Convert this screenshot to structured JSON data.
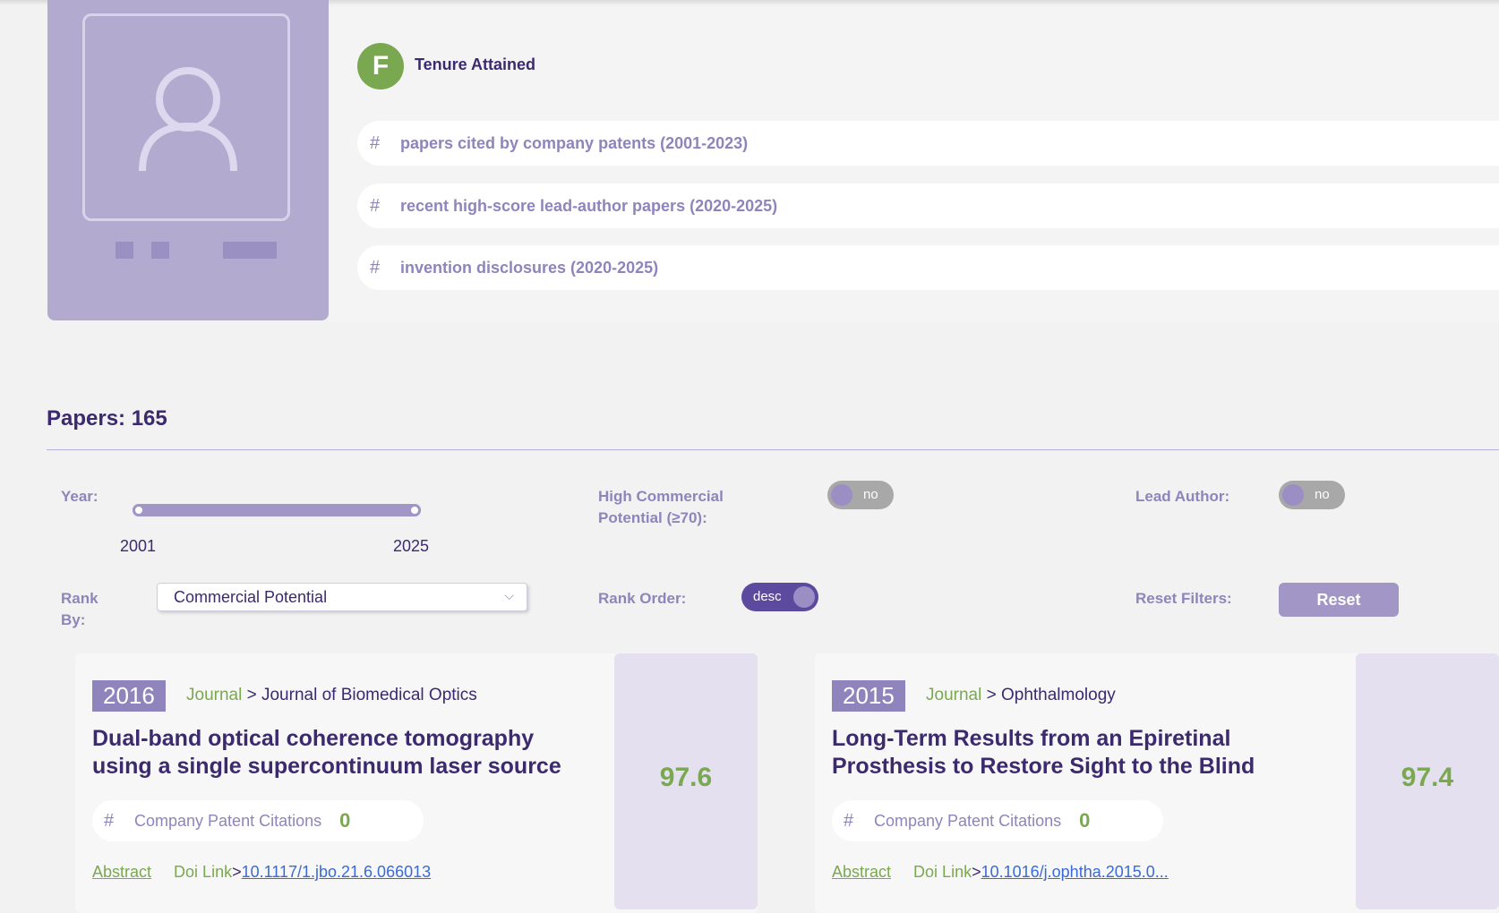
{
  "profile": {
    "tenure_initial": "F",
    "tenure_label": "Tenure Attained",
    "metrics": [
      {
        "label": "papers cited by company patents (2001-2023)"
      },
      {
        "label": "recent high-score lead-author papers (2020-2025)"
      },
      {
        "label": "invention disclosures (2020-2025)"
      }
    ]
  },
  "papers": {
    "title": "Papers: 165"
  },
  "filters": {
    "year_label": "Year:",
    "year_min": "2001",
    "year_max": "2025",
    "high_commercial_label": "High Commercial Potential (≥70):",
    "high_commercial_value": "no",
    "lead_author_label": "Lead Author:",
    "lead_author_value": "no",
    "rank_by_label": "Rank By:",
    "rank_by_value": "Commercial Potential",
    "rank_order_label": "Rank Order:",
    "rank_order_value": "desc",
    "reset_label": "Reset Filters:",
    "reset_button": "Reset"
  },
  "cards": [
    {
      "year": "2016",
      "venue_type": "Journal",
      "venue_name": "Journal of Biomedical Optics",
      "title": "Dual-band optical coherence tomography using a single supercontinuum laser source",
      "citations_label": "Company Patent Citations",
      "citations_value": "0",
      "score": "97.6",
      "abstract_label": "Abstract",
      "doi_label": "Doi Link",
      "doi": "10.1117/1.jbo.21.6.066013"
    },
    {
      "year": "2015",
      "venue_type": "Journal",
      "venue_name": "Ophthalmology",
      "title": "Long-Term Results from an Epiretinal Prosthesis to Restore Sight to the Blind",
      "citations_label": "Company Patent Citations",
      "citations_value": "0",
      "score": "97.4",
      "abstract_label": "Abstract",
      "doi_label": "Doi Link",
      "doi": "10.1016/j.ophtha.2015.0..."
    }
  ],
  "colors": {
    "primary": "#3c2a6e",
    "accent_purple": "#8f84bb",
    "accent_green": "#7aa851",
    "link_blue": "#3a6ad4"
  }
}
